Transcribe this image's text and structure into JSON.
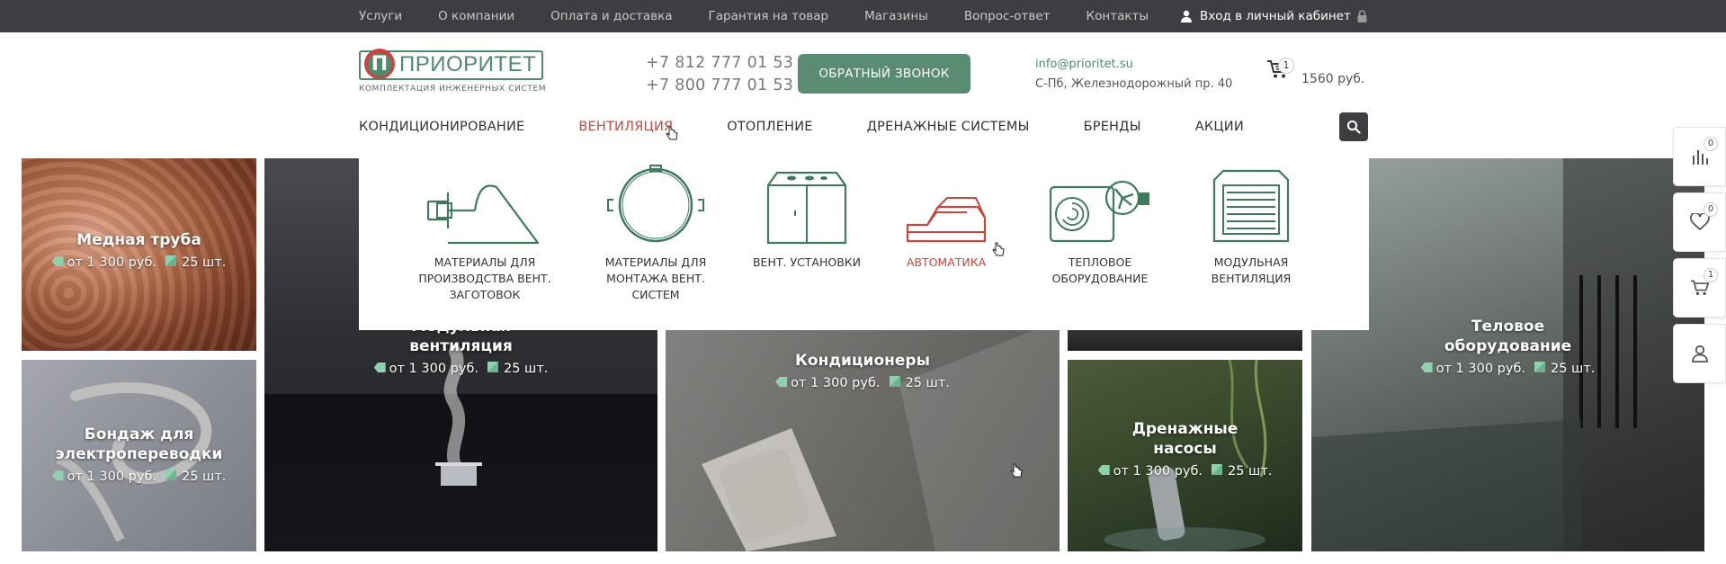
{
  "topbar": {
    "links": [
      "Услуги",
      "О компании",
      "Оплата и доставка",
      "Гарантия на товар",
      "Магазины",
      "Вопрос-ответ",
      "Контакты"
    ],
    "login_label": "Вход в личный кабинет"
  },
  "header": {
    "logo_letter": "П",
    "logo_name": "ПРИОРИТЕТ",
    "logo_sub": "КОМПЛЕКТАЦИЯ ИНЖЕНЕРНЫХ СИСТЕМ",
    "phone1": "+7 812 777 01 53",
    "phone2": "+7 800 777 01 53",
    "callback_label": "ОБРАТНЫЙ ЗВОНОК",
    "email": "info@prioritet.su",
    "address": "С-Пб, Железнодорожный пр. 40",
    "cart_count": "1",
    "cart_sum": "1560 руб."
  },
  "mainnav": {
    "items": [
      "КОНДИЦИОНИРОВАНИЕ",
      "ВЕНТИЛЯЦИЯ",
      "ОТОПЛЕНИЕ",
      "ДРЕНАЖНЫЕ СИСТЕМЫ",
      "БРЕНДЫ",
      "АКЦИИ"
    ],
    "active_index": 1
  },
  "dropdown": {
    "items": [
      {
        "label": "МАТЕРИАЛЫ ДЛЯ ПРОИЗВОДСТВА ВЕНТ. ЗАГОТОВОК",
        "icon": "bracket-clamp-icon"
      },
      {
        "label": "МАТЕРИАЛЫ ДЛЯ МОНТАЖА ВЕНТ. СИСТЕМ",
        "icon": "duct-clamp-icon"
      },
      {
        "label": "ВЕНТ. УСТАНОВКИ",
        "icon": "vent-unit-icon"
      },
      {
        "label": "АВТОМАТИКА",
        "icon": "automation-icon"
      },
      {
        "label": "ТЕПЛОВОЕ ОБОРУДОВАНИЕ",
        "icon": "heat-fan-icon"
      },
      {
        "label": "МОДУЛЬНАЯ ВЕНТИЛЯЦИЯ",
        "icon": "modular-vent-icon"
      }
    ],
    "active_index": 3
  },
  "tiles": {
    "t1": {
      "title": "Медная труба",
      "price": "от 1 300 руб.",
      "qty": "25 шт."
    },
    "t2": {
      "title": "Бондаж для электропереводки",
      "price": "от 1 300 руб.",
      "qty": "25 шт."
    },
    "t3": {
      "title": "Модульная вентиляция",
      "price": "от 1 300 руб.",
      "qty": "25 шт."
    },
    "t4": {
      "title": "Кондиционеры",
      "price": "от 1 300 руб.",
      "qty": "25 шт."
    },
    "t5": {
      "title": "Дренажные насосы",
      "price": "от 1 300 руб.",
      "qty": "25 шт."
    },
    "t6": {
      "title": "Теловое оборудование",
      "price": "от 1 300 руб.",
      "qty": "25 шт."
    }
  },
  "side": {
    "compare_count": "0",
    "favorites_count": "0",
    "cart_count": "1"
  },
  "colors": {
    "brand_green": "#4f8a6e",
    "accent_red": "#c9463f",
    "topbar_bg": "#3e3e42"
  }
}
